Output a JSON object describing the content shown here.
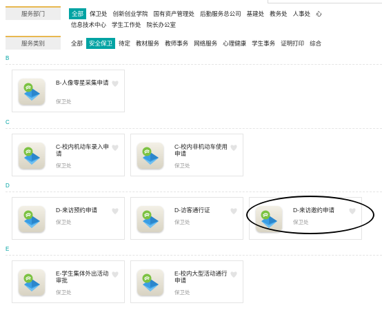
{
  "filters": {
    "department": {
      "label": "服务部门",
      "items": [
        "全部",
        "保卫处",
        "创新创业学院",
        "国有资产管理处",
        "后勤服务总公司",
        "基建处",
        "教务处",
        "人事处",
        "心"
      ],
      "items_row2": [
        "信息技术中心",
        "学生工作处",
        "院长办公室"
      ],
      "active": "全部"
    },
    "category": {
      "label": "服务类别",
      "items": [
        "全部",
        "安全保卫",
        "待定",
        "教材服务",
        "教师事务",
        "网络服务",
        "心理健康",
        "学生事务",
        "证明打印",
        "综合"
      ],
      "active": "安全保卫"
    }
  },
  "sections": [
    {
      "letter": "B",
      "cards": [
        {
          "title": "B-人像零星采集申请",
          "dept": "保卫处"
        }
      ]
    },
    {
      "letter": "C",
      "cards": [
        {
          "title": "C-校内机动车录入申请",
          "dept": "保卫处"
        },
        {
          "title": "C-校内非机动车使用申请",
          "dept": "保卫处"
        }
      ]
    },
    {
      "letter": "D",
      "cards": [
        {
          "title": "D-来访预约申请",
          "dept": "保卫处"
        },
        {
          "title": "D-访客通行证",
          "dept": "保卫处"
        },
        {
          "title": "D-来访邀约申请",
          "dept": "保卫处"
        }
      ]
    },
    {
      "letter": "E",
      "cards": [
        {
          "title": "E-学生集体外出活动审批",
          "dept": "保卫处"
        },
        {
          "title": "E-校内大型活动通行申请",
          "dept": "保卫处"
        }
      ]
    }
  ],
  "colors": {
    "accent": "#00a3a3",
    "label_border": "#e8b84f"
  },
  "icons": {
    "service": "service-app-icon",
    "favorite": "heart-icon"
  }
}
